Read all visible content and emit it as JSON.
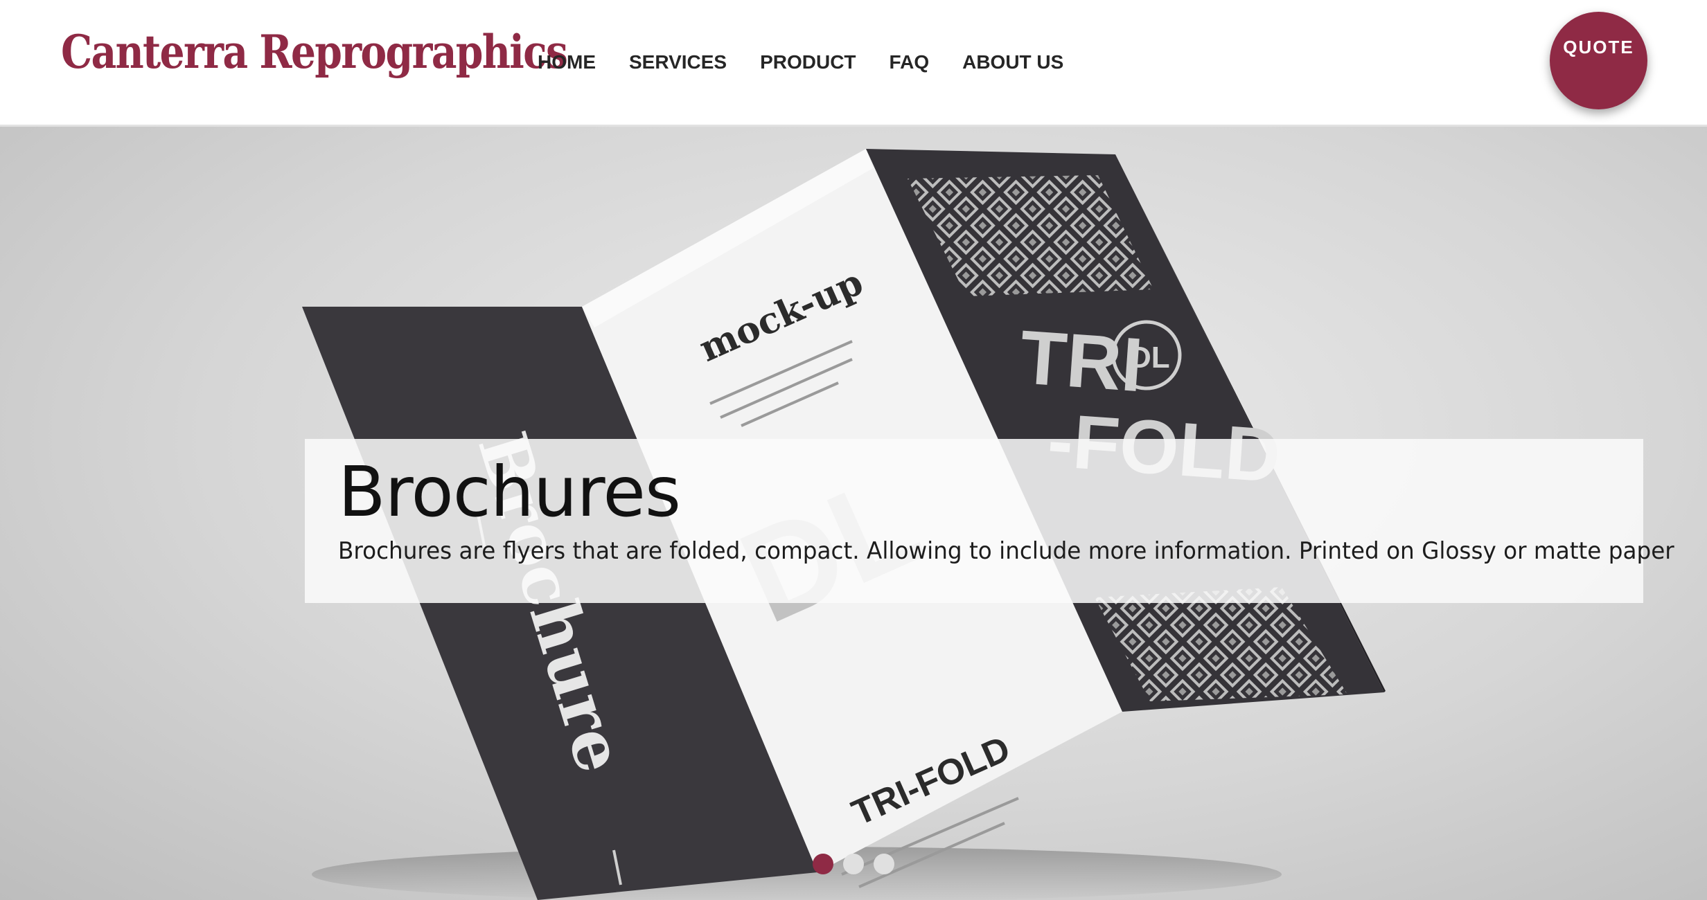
{
  "brand": {
    "logo_text": "Canterra Reprographics",
    "accent_color": "#8f2a45"
  },
  "nav": {
    "items": [
      {
        "label": "HOME"
      },
      {
        "label": "SERVICES"
      },
      {
        "label": "PRODUCT"
      },
      {
        "label": "FAQ"
      },
      {
        "label": "ABOUT US"
      }
    ]
  },
  "quote_button": {
    "label": "QUOTE"
  },
  "hero": {
    "image_subject": "tri-fold brochure mockup",
    "panel_texts": {
      "left_vertical": "Brochure",
      "middle_top": "mock-up",
      "middle_large": "DL",
      "middle_bottom": "TRI-FOLD",
      "right_large_line1": "TRI",
      "right_badge": "DL",
      "right_large_line2": "-FOLD"
    },
    "caption": {
      "title": "Brochures",
      "text": "Brochures are flyers that are folded, compact. Allowing to include more information. Printed on Glossy or matte paper"
    },
    "slider": {
      "total": 3,
      "active": 1
    }
  }
}
